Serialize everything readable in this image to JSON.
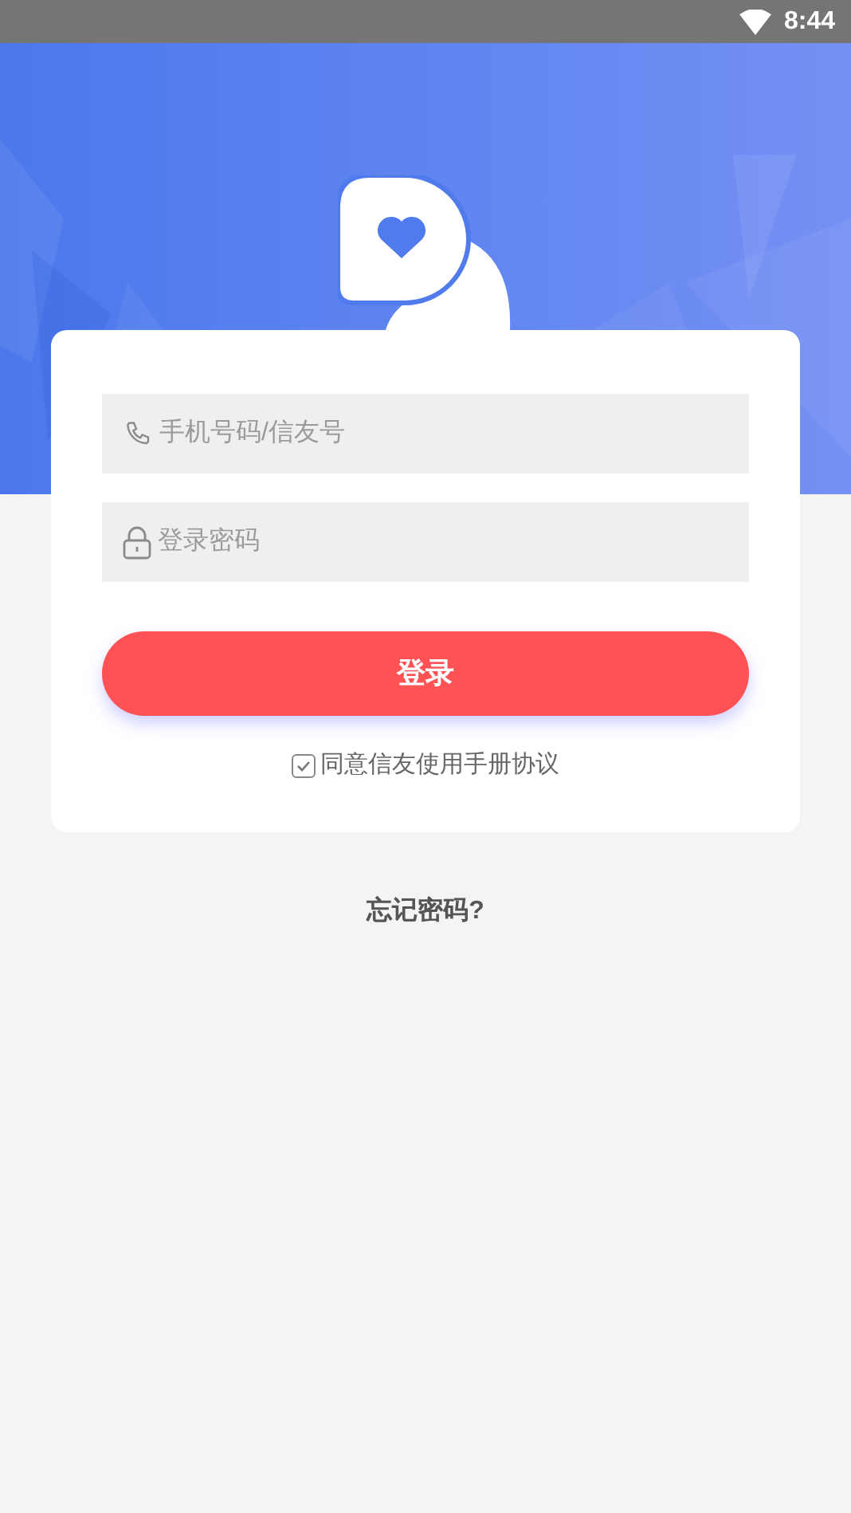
{
  "status_bar": {
    "time": "8:44"
  },
  "login_form": {
    "phone_field": {
      "placeholder": "手机号码/信友号"
    },
    "password_field": {
      "placeholder": "登录密码"
    },
    "login_button": "登录",
    "agreement": {
      "label": "同意信友使用手册协议",
      "checked": true
    }
  },
  "forgot_password": "忘记密码?"
}
